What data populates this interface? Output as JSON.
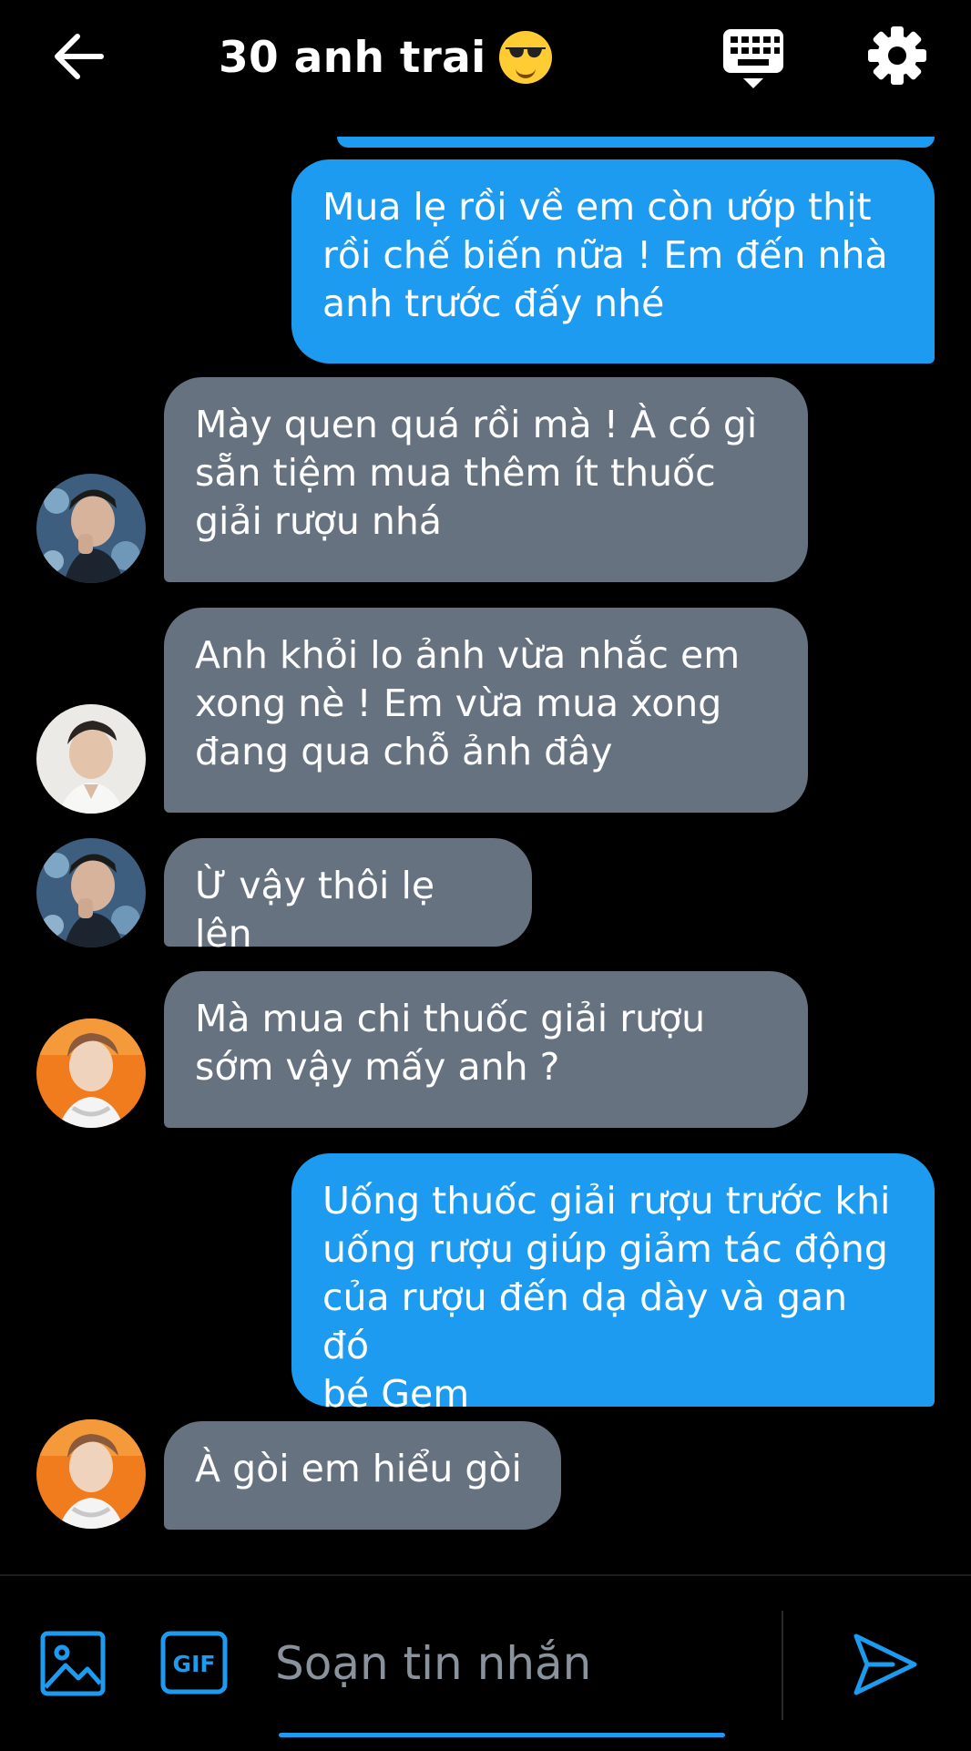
{
  "header": {
    "title": "30 anh trai",
    "title_emoji": "smiling-face-with-sunglasses",
    "back_icon": "arrow-left-icon",
    "keyboard_icon": "keyboard-icon",
    "settings_icon": "gear-icon"
  },
  "messages": [
    {
      "direction": "out",
      "text": "Mua lẹ rồi về em còn ướp thịt\nrồi chế biến nữa ! Em đến nhà\nanh trước đấy nhé"
    },
    {
      "direction": "in",
      "avatar": "avatar-man-blue-floral",
      "text": "Mày quen quá rồi mà ! À có gì\nsẵn tiệm mua thêm ít thuốc\ngiải rượu nhá"
    },
    {
      "direction": "in",
      "avatar": "avatar-man-white",
      "text": "Anh khỏi lo ảnh vừa nhắc em\nxong nè ! Em vừa mua xong\nđang qua chỗ ảnh đây"
    },
    {
      "direction": "in",
      "avatar": "avatar-man-blue-floral",
      "text": "Ừ vậy thôi lẹ lên"
    },
    {
      "direction": "in",
      "avatar": "avatar-man-orange",
      "text": "Mà mua chi thuốc giải rượu\nsớm vậy mấy anh ?"
    },
    {
      "direction": "out",
      "text": " Uống thuốc giải rượu trước khi\nuống rượu giúp giảm tác động\ncủa rượu đến dạ dày và gan đó\nbé Gem"
    },
    {
      "direction": "in",
      "avatar": "avatar-man-orange",
      "text": "À gòi em hiểu gòi"
    }
  ],
  "composer": {
    "placeholder": "Soạn tin nhắn",
    "value": "",
    "gif_label": "GIF",
    "image_icon": "image-icon",
    "send_icon": "send-icon"
  },
  "colors": {
    "accent": "#1d9bf0",
    "incoming_bubble": "#66727f",
    "background": "#000000"
  }
}
